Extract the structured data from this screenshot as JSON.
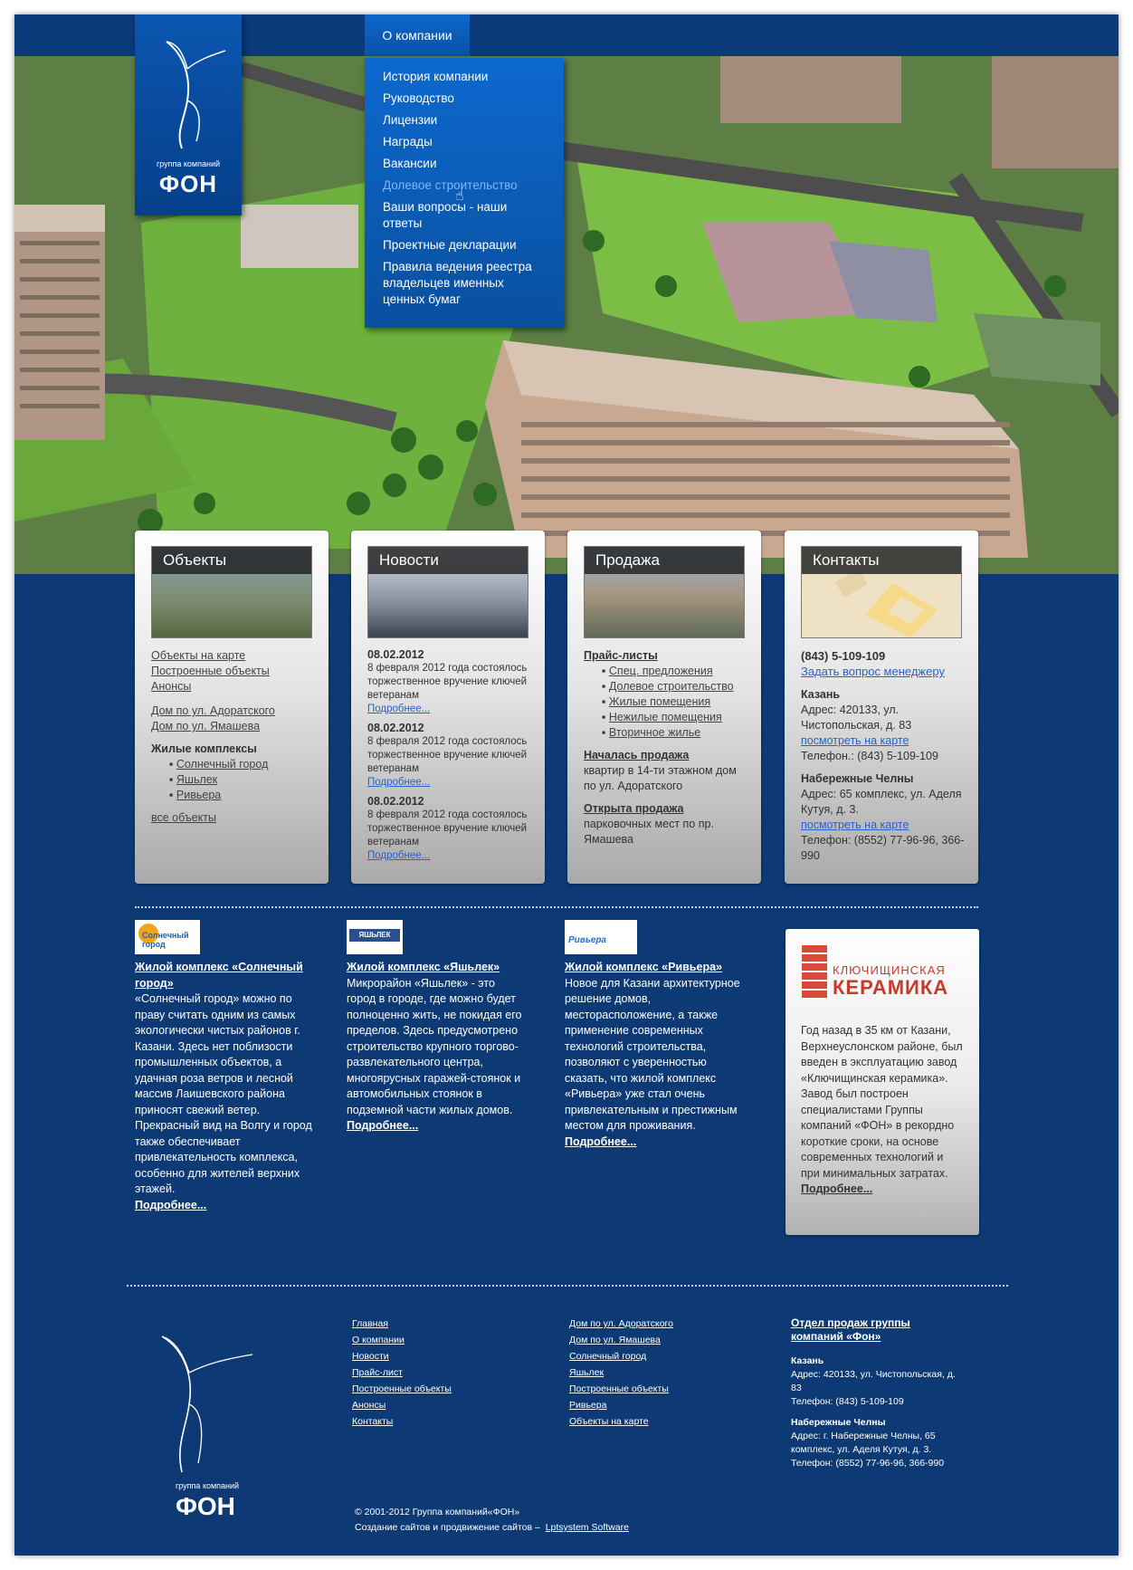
{
  "logo": {
    "sub": "группа компаний",
    "name": "ФОН"
  },
  "nav": {
    "tab": "О компании",
    "menu": [
      "История компании",
      "Руководство",
      "Лицензии",
      "Награды",
      "Вакансии",
      "Долевое строительство",
      "Ваши вопросы - наши ответы",
      "Проектные декларации",
      "Правила ведения реестра владельцев именных ценных бумаг"
    ]
  },
  "cards": {
    "objects": {
      "title": "Объекты",
      "links1": [
        "Объекты на карте",
        "Построенные объекты",
        "Анонсы"
      ],
      "links2": [
        "Дом по ул. Адоратского",
        "Дом по ул. Ямашева"
      ],
      "complexes_title": "Жилые комплексы",
      "complexes": [
        "Солнечный город",
        "Яшьлек",
        "Ривьера"
      ],
      "all": "все объекты"
    },
    "news": {
      "title": "Новости",
      "items": [
        {
          "date": "08.02.2012",
          "text": "8 февраля 2012 года состоялось торжественное вручение ключей ветеранам",
          "more": "Подробнее..."
        },
        {
          "date": "08.02.2012",
          "text": "8 февраля 2012 года состоялось торжественное вручение ключей ветеранам",
          "more": "Подробнее..."
        },
        {
          "date": "08.02.2012",
          "text": "8 февраля 2012 года состоялось торжественное вручение ключей ветеранам",
          "more": "Подробнее..."
        }
      ]
    },
    "sales": {
      "title": "Продажа",
      "price_title": "Прайс-листы",
      "price_items": [
        "Спец. предложения",
        "Долевое строительство",
        "Жилые помещения",
        "Нежилые помещения",
        "Вторичное жилье"
      ],
      "n1_title": "Началась продажа",
      "n1_text": "квартир в 14-ти этажном дом по ул. Адоратского",
      "n2_title": "Открыта продажа",
      "n2_text": "парковочных мест по пр. Ямашева"
    },
    "contacts": {
      "title": "Контакты",
      "phone": "(843) 5-109-109",
      "ask": "Задать вопрос менеджеру",
      "city1": "Казань",
      "addr1": "Адрес: 420133, ул. Чистопольская, д. 83",
      "map1": "посмотреть на карте",
      "tel1": "Телефон.: (843) 5-109-109",
      "city2": "Набережные Челны",
      "addr2": "Адрес: 65 комплекс, ул. Аделя Кутуя, д. 3.",
      "map2": "посмотреть на карте",
      "tel2": "Телефон: (8552) 77-96-96, 366-990"
    }
  },
  "promos": [
    {
      "logo": "Солнечный город",
      "title": "Жилой комплекс «Солнечный город»",
      "text": "«Солнечный город» можно по праву считать одним из самых экологически чистых районов г. Казани. Здесь нет поблизости промышленных объектов, а удачная роза ветров и лесной массив Лаишевского района приносят свежий ветер. Прекрасный вид на Волгу и город также обеспечивает привлекательность комплекса, особенно для жителей верхних этажей.",
      "more": "Подробнее..."
    },
    {
      "logo": "ЯШЬЛЕК",
      "title": "Жилой комплекс «Яшьлек»",
      "text": "Микрорайон «Яшьлек» - это город в городе, где можно будет полноценно жить, не покидая его пределов. Здесь предусмотрено строительство крупного торгово-развлекательного центра, многоярусных гаражей-стоянок и автомобильных стоянок в подземной части жилых домов.",
      "more": "Подробнее..."
    },
    {
      "logo": "Ривьера",
      "title": "Жилой комплекс «Ривьера»",
      "text": "Новое для Казани архитектурное решение домов, месторасположение, а также применение современных технологий строительства, позволяют с уверенностью сказать, что жилой комплекс «Ривьера» уже стал очень привлекательным и престижным местом для проживания.",
      "more": "Подробнее..."
    }
  ],
  "ceramic": {
    "brand_top": "КЛЮЧИЩИНСКАЯ",
    "brand": "КЕРАМИКА",
    "text": "Год назад в 35 км от Казани, Верхнеуслонском районе, был введен в эксплуатацию завод «Ключищинская керамика». Завод был построен специалистами Группы компаний «ФОН» в рекордно короткие сроки, на основе современных технологий и при минимальных затратах.",
    "more": "Подробнее..."
  },
  "footer": {
    "col1": [
      "Главная",
      "О компании",
      "Новости",
      "Прайс-лист",
      "Построенные объекты",
      "Анонсы",
      "Контакты"
    ],
    "col2": [
      "Дом по ул. Адоратского",
      "Дом по ул. Ямашева",
      "Солнечный город",
      "Яшьлек",
      "Построенные объекты",
      "Ривьера",
      "Объекты на карте"
    ],
    "dept": "Отдел продаж группы компаний «Фон»",
    "city1": "Казань",
    "addr1": "Адрес: 420133,  ул. Чистопольская, д. 83",
    "tel1": "Телефон: (843) 5-109-109",
    "city2": "Набережные Челны",
    "addr2": "Адрес:  г. Набережные Челны, 65 комплекс, ул. Аделя Кутуя, д. 3.",
    "tel2": "Телефон: (8552) 77-96-96, 366-990",
    "copyright": "© 2001-2012 Группа компаний«ФОН»",
    "dev_prefix": "Создание сайтов и продвижение сайтов –",
    "dev_link": "Lptsystem Software"
  }
}
